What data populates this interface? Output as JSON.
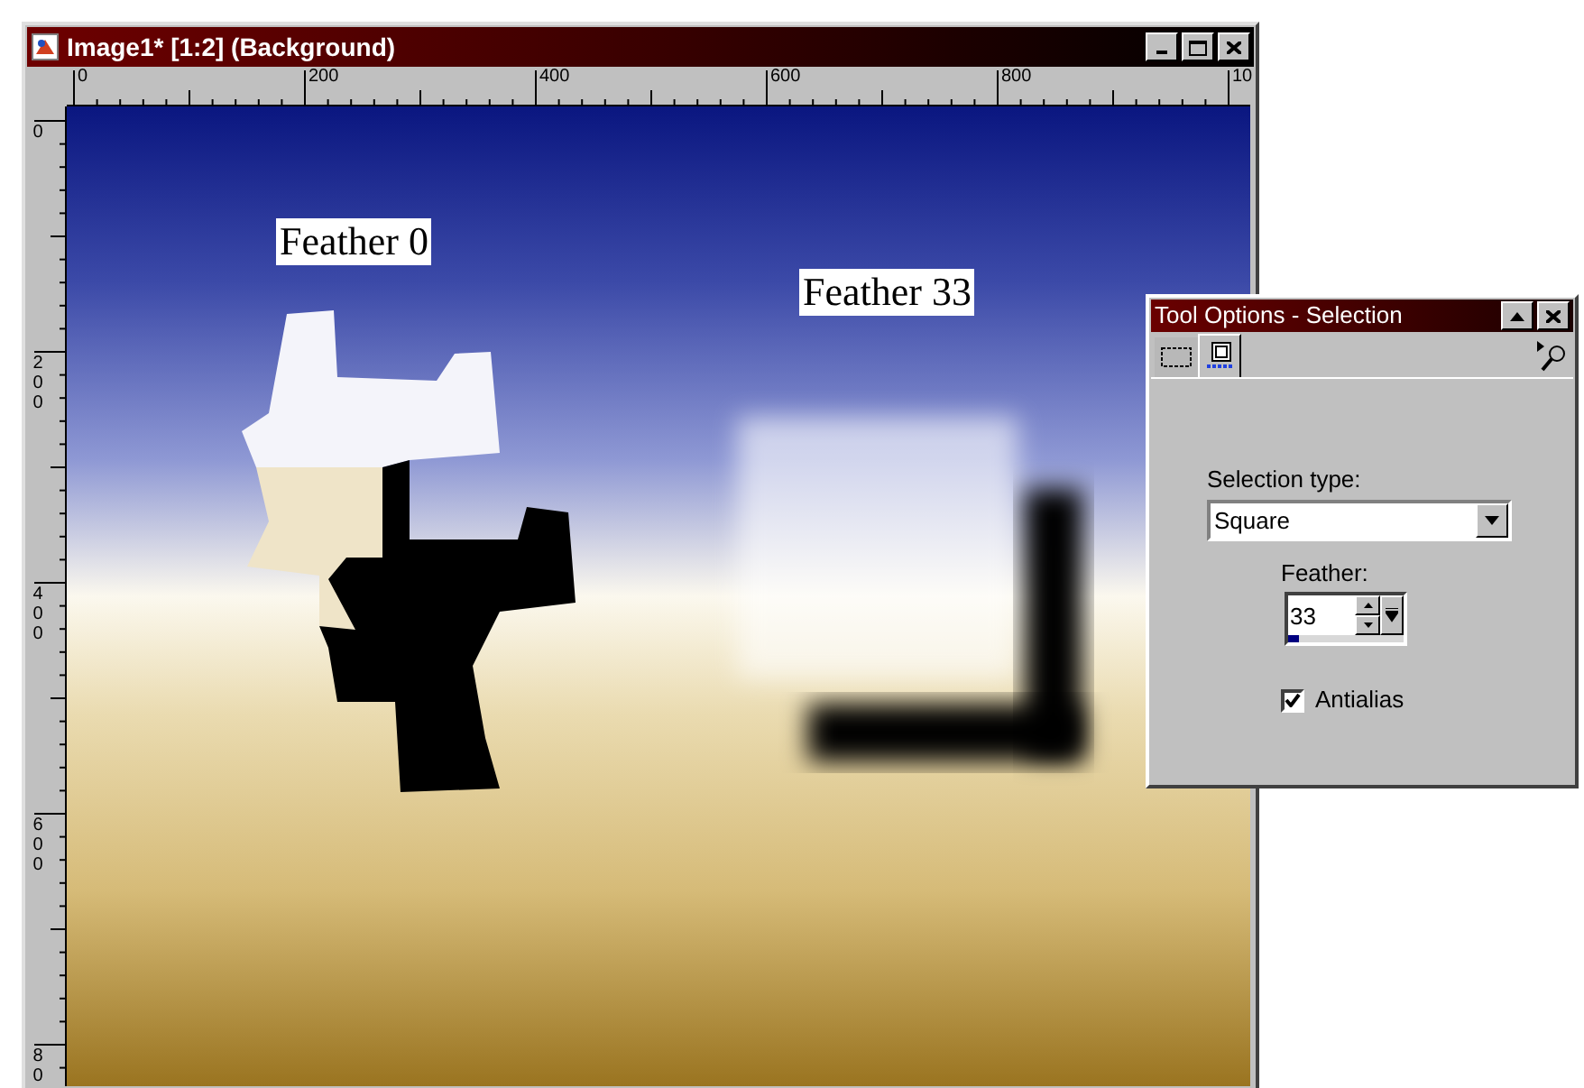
{
  "window": {
    "title": "Image1* [1:2] (Background)"
  },
  "rulers": {
    "horizontal": [
      "0",
      "200",
      "400",
      "600",
      "800",
      "10"
    ],
    "vertical": [
      "0",
      "200",
      "400",
      "600",
      "80"
    ]
  },
  "canvas": {
    "labels": [
      "Feather 0",
      "Feather 33"
    ]
  },
  "tool_options": {
    "title": "Tool Options - Selection",
    "tabs": [
      {
        "selected": false
      },
      {
        "selected": true
      }
    ],
    "selection_type": {
      "label": "Selection type:",
      "value": "Square"
    },
    "feather": {
      "label": "Feather:",
      "value": "33",
      "level": 0.1
    },
    "antialias": {
      "label": "Antialias",
      "checked": true
    }
  }
}
